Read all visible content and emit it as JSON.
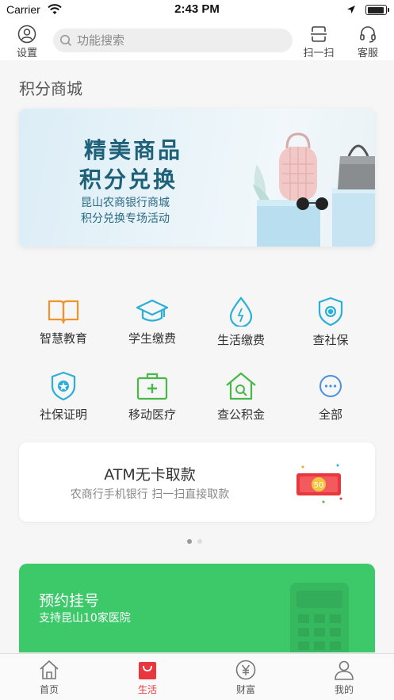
{
  "status_bar": {
    "carrier": "Carrier",
    "time": "2:43 PM"
  },
  "nav": {
    "settings_label": "设置",
    "search_placeholder": "功能搜索",
    "scan_label": "扫一扫",
    "service_label": "客服"
  },
  "section_title": "积分商城",
  "banner": {
    "line1": "精美商品",
    "line2": "积分兑换",
    "line3": "昆山农商银行商城",
    "line4": "积分兑换专场活动"
  },
  "services": [
    {
      "label": "智慧教育",
      "icon": "book-icon",
      "color": "#f0932b"
    },
    {
      "label": "学生缴费",
      "icon": "graduation-cap-icon",
      "color": "#2ab0d8"
    },
    {
      "label": "生活缴费",
      "icon": "water-drop-icon",
      "color": "#2ab0d8"
    },
    {
      "label": "查社保",
      "icon": "shield-icon",
      "color": "#2ab0d8"
    },
    {
      "label": "社保证明",
      "icon": "shield-badge-icon",
      "color": "#2ab0d8"
    },
    {
      "label": "移动医疗",
      "icon": "medical-kit-icon",
      "color": "#48b848"
    },
    {
      "label": "查公积金",
      "icon": "house-search-icon",
      "color": "#48b848"
    },
    {
      "label": "全部",
      "icon": "more-icon",
      "color": "#4a90e2"
    }
  ],
  "atm_card": {
    "title": "ATM无卡取款",
    "subtitle": "农商行手机银行   扫一扫直接取款",
    "badge_value": "50"
  },
  "green_card": {
    "title": "预约挂号",
    "subtitle": "支持昆山10家医院"
  },
  "tabbar": [
    {
      "label": "首页",
      "icon": "home-icon",
      "active": false
    },
    {
      "label": "生活",
      "icon": "shopping-bag-icon",
      "active": true
    },
    {
      "label": "财富",
      "icon": "yen-coin-icon",
      "active": false
    },
    {
      "label": "我的",
      "icon": "person-icon",
      "active": false
    }
  ],
  "colors": {
    "accent_red": "#e8383d",
    "green": "#3dc96a",
    "banner_text": "#1f6179"
  }
}
